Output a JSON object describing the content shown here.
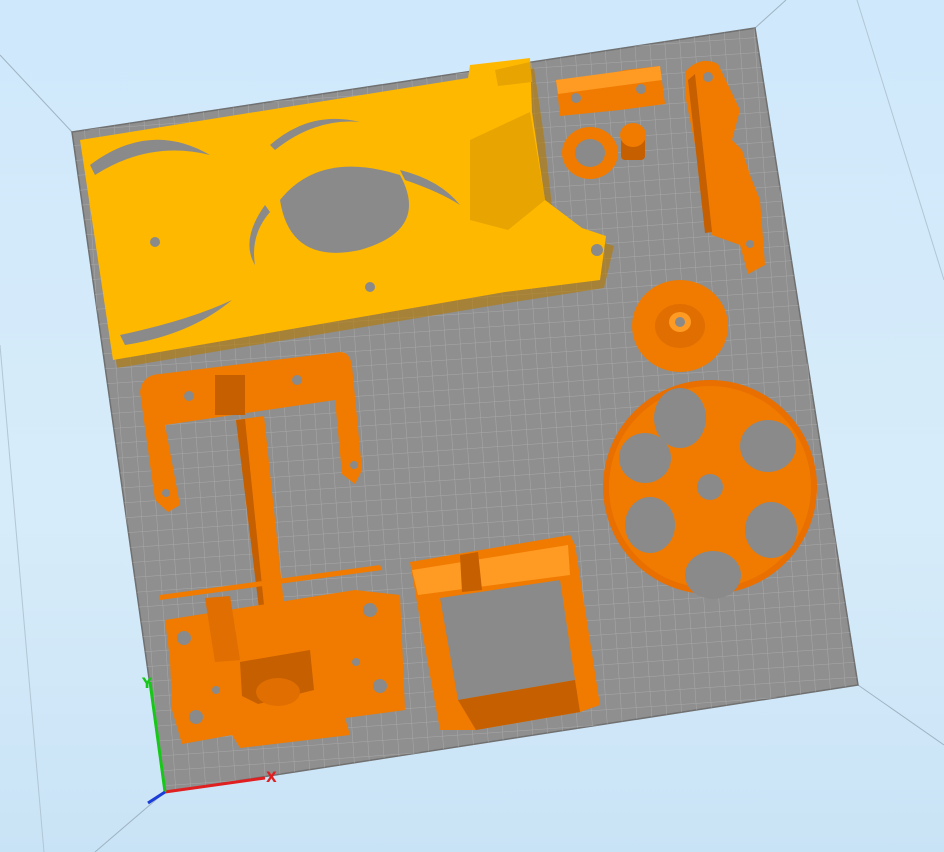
{
  "viewport": {
    "background_top": "#cfe8fb",
    "background_bottom": "#c9e3f6"
  },
  "build_plate": {
    "plate_color": "#8f8f8f",
    "grid_line_color": "#a6a6a6",
    "plate_edge_color": "#6f6f6f"
  },
  "parts": {
    "selected_color": "#ffb800",
    "unselected_color": "#f07b00",
    "shadow_color": "#b85a00",
    "hole_color": "#8a8a8a",
    "items": [
      {
        "name": "side-plate-part",
        "selected": true
      },
      {
        "name": "bracket-part",
        "selected": false
      },
      {
        "name": "spacer-ring-part",
        "selected": false
      },
      {
        "name": "pin-part",
        "selected": false
      },
      {
        "name": "arm-part",
        "selected": false
      },
      {
        "name": "small-gear-part",
        "selected": false
      },
      {
        "name": "large-gear-part",
        "selected": false
      },
      {
        "name": "u-frame-part",
        "selected": false
      },
      {
        "name": "motor-mount-part",
        "selected": false
      },
      {
        "name": "box-frame-part",
        "selected": false
      }
    ]
  },
  "axes": {
    "x_label": "X",
    "y_label": "Y",
    "x_color": "#e02020",
    "y_color": "#18c818",
    "z_color": "#1a3cd8"
  }
}
